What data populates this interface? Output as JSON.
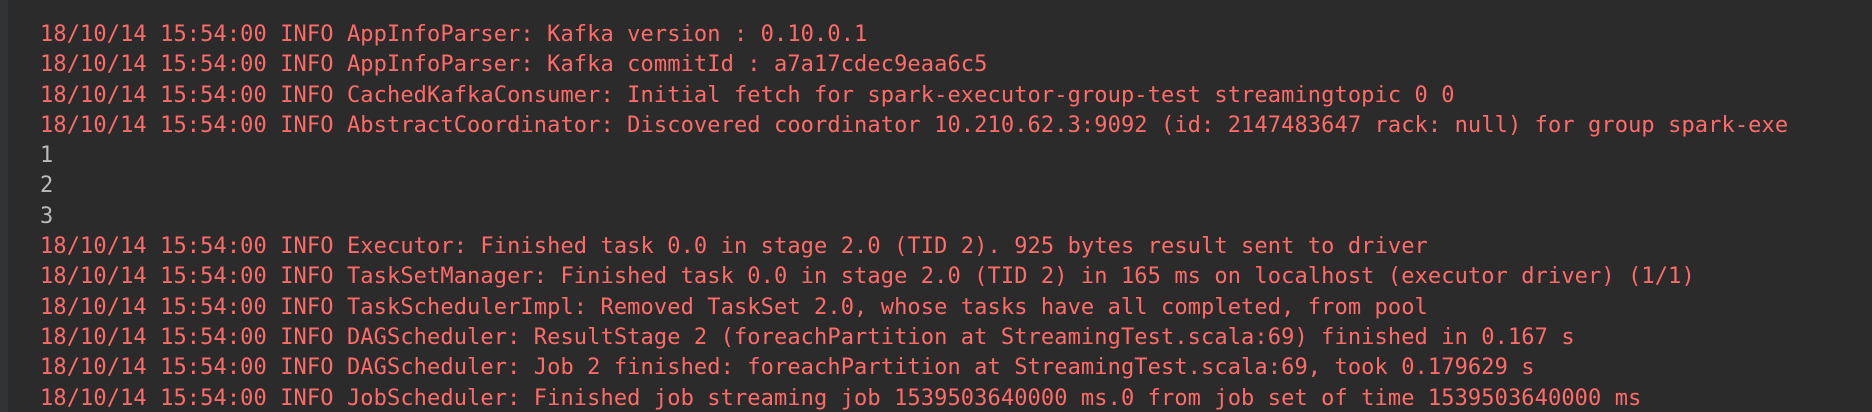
{
  "console": {
    "lines": [
      {
        "kind": "log",
        "text": "18/10/14 15:54:00 INFO AppInfoParser: Kafka version : 0.10.0.1"
      },
      {
        "kind": "log",
        "text": "18/10/14 15:54:00 INFO AppInfoParser: Kafka commitId : a7a17cdec9eaa6c5"
      },
      {
        "kind": "log",
        "text": "18/10/14 15:54:00 INFO CachedKafkaConsumer: Initial fetch for spark-executor-group-test streamingtopic 0 0"
      },
      {
        "kind": "log",
        "text": "18/10/14 15:54:00 INFO AbstractCoordinator: Discovered coordinator 10.210.62.3:9092 (id: 2147483647 rack: null) for group spark-exe"
      },
      {
        "kind": "stdout",
        "text": "1"
      },
      {
        "kind": "stdout",
        "text": "2"
      },
      {
        "kind": "stdout",
        "text": "3"
      },
      {
        "kind": "log",
        "text": "18/10/14 15:54:00 INFO Executor: Finished task 0.0 in stage 2.0 (TID 2). 925 bytes result sent to driver"
      },
      {
        "kind": "log",
        "text": "18/10/14 15:54:00 INFO TaskSetManager: Finished task 0.0 in stage 2.0 (TID 2) in 165 ms on localhost (executor driver) (1/1)"
      },
      {
        "kind": "log",
        "text": "18/10/14 15:54:00 INFO TaskSchedulerImpl: Removed TaskSet 2.0, whose tasks have all completed, from pool"
      },
      {
        "kind": "log",
        "text": "18/10/14 15:54:00 INFO DAGScheduler: ResultStage 2 (foreachPartition at StreamingTest.scala:69) finished in 0.167 s"
      },
      {
        "kind": "log",
        "text": "18/10/14 15:54:00 INFO DAGScheduler: Job 2 finished: foreachPartition at StreamingTest.scala:69, took 0.179629 s"
      },
      {
        "kind": "log",
        "text": "18/10/14 15:54:00 INFO JobScheduler: Finished job streaming job 1539503640000 ms.0 from job set of time 1539503640000 ms"
      }
    ]
  },
  "colors": {
    "background": "#2b2b2b",
    "log_text": "#ff6b68",
    "stdout_text": "#bbbbbb"
  }
}
